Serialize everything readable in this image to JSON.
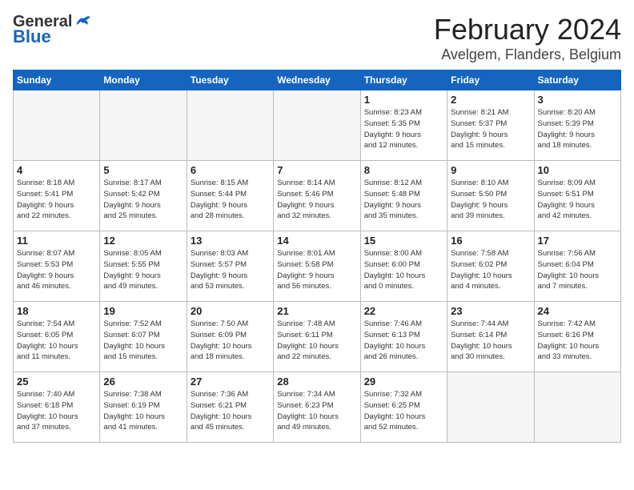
{
  "header": {
    "logo_general": "General",
    "logo_blue": "Blue",
    "month_year": "February 2024",
    "location": "Avelgem, Flanders, Belgium"
  },
  "weekdays": [
    "Sunday",
    "Monday",
    "Tuesday",
    "Wednesday",
    "Thursday",
    "Friday",
    "Saturday"
  ],
  "weeks": [
    [
      {
        "day": "",
        "info": ""
      },
      {
        "day": "",
        "info": ""
      },
      {
        "day": "",
        "info": ""
      },
      {
        "day": "",
        "info": ""
      },
      {
        "day": "1",
        "info": "Sunrise: 8:23 AM\nSunset: 5:35 PM\nDaylight: 9 hours\nand 12 minutes."
      },
      {
        "day": "2",
        "info": "Sunrise: 8:21 AM\nSunset: 5:37 PM\nDaylight: 9 hours\nand 15 minutes."
      },
      {
        "day": "3",
        "info": "Sunrise: 8:20 AM\nSunset: 5:39 PM\nDaylight: 9 hours\nand 18 minutes."
      }
    ],
    [
      {
        "day": "4",
        "info": "Sunrise: 8:18 AM\nSunset: 5:41 PM\nDaylight: 9 hours\nand 22 minutes."
      },
      {
        "day": "5",
        "info": "Sunrise: 8:17 AM\nSunset: 5:42 PM\nDaylight: 9 hours\nand 25 minutes."
      },
      {
        "day": "6",
        "info": "Sunrise: 8:15 AM\nSunset: 5:44 PM\nDaylight: 9 hours\nand 28 minutes."
      },
      {
        "day": "7",
        "info": "Sunrise: 8:14 AM\nSunset: 5:46 PM\nDaylight: 9 hours\nand 32 minutes."
      },
      {
        "day": "8",
        "info": "Sunrise: 8:12 AM\nSunset: 5:48 PM\nDaylight: 9 hours\nand 35 minutes."
      },
      {
        "day": "9",
        "info": "Sunrise: 8:10 AM\nSunset: 5:50 PM\nDaylight: 9 hours\nand 39 minutes."
      },
      {
        "day": "10",
        "info": "Sunrise: 8:09 AM\nSunset: 5:51 PM\nDaylight: 9 hours\nand 42 minutes."
      }
    ],
    [
      {
        "day": "11",
        "info": "Sunrise: 8:07 AM\nSunset: 5:53 PM\nDaylight: 9 hours\nand 46 minutes."
      },
      {
        "day": "12",
        "info": "Sunrise: 8:05 AM\nSunset: 5:55 PM\nDaylight: 9 hours\nand 49 minutes."
      },
      {
        "day": "13",
        "info": "Sunrise: 8:03 AM\nSunset: 5:57 PM\nDaylight: 9 hours\nand 53 minutes."
      },
      {
        "day": "14",
        "info": "Sunrise: 8:01 AM\nSunset: 5:58 PM\nDaylight: 9 hours\nand 56 minutes."
      },
      {
        "day": "15",
        "info": "Sunrise: 8:00 AM\nSunset: 6:00 PM\nDaylight: 10 hours\nand 0 minutes."
      },
      {
        "day": "16",
        "info": "Sunrise: 7:58 AM\nSunset: 6:02 PM\nDaylight: 10 hours\nand 4 minutes."
      },
      {
        "day": "17",
        "info": "Sunrise: 7:56 AM\nSunset: 6:04 PM\nDaylight: 10 hours\nand 7 minutes."
      }
    ],
    [
      {
        "day": "18",
        "info": "Sunrise: 7:54 AM\nSunset: 6:05 PM\nDaylight: 10 hours\nand 11 minutes."
      },
      {
        "day": "19",
        "info": "Sunrise: 7:52 AM\nSunset: 6:07 PM\nDaylight: 10 hours\nand 15 minutes."
      },
      {
        "day": "20",
        "info": "Sunrise: 7:50 AM\nSunset: 6:09 PM\nDaylight: 10 hours\nand 18 minutes."
      },
      {
        "day": "21",
        "info": "Sunrise: 7:48 AM\nSunset: 6:11 PM\nDaylight: 10 hours\nand 22 minutes."
      },
      {
        "day": "22",
        "info": "Sunrise: 7:46 AM\nSunset: 6:13 PM\nDaylight: 10 hours\nand 26 minutes."
      },
      {
        "day": "23",
        "info": "Sunrise: 7:44 AM\nSunset: 6:14 PM\nDaylight: 10 hours\nand 30 minutes."
      },
      {
        "day": "24",
        "info": "Sunrise: 7:42 AM\nSunset: 6:16 PM\nDaylight: 10 hours\nand 33 minutes."
      }
    ],
    [
      {
        "day": "25",
        "info": "Sunrise: 7:40 AM\nSunset: 6:18 PM\nDaylight: 10 hours\nand 37 minutes."
      },
      {
        "day": "26",
        "info": "Sunrise: 7:38 AM\nSunset: 6:19 PM\nDaylight: 10 hours\nand 41 minutes."
      },
      {
        "day": "27",
        "info": "Sunrise: 7:36 AM\nSunset: 6:21 PM\nDaylight: 10 hours\nand 45 minutes."
      },
      {
        "day": "28",
        "info": "Sunrise: 7:34 AM\nSunset: 6:23 PM\nDaylight: 10 hours\nand 49 minutes."
      },
      {
        "day": "29",
        "info": "Sunrise: 7:32 AM\nSunset: 6:25 PM\nDaylight: 10 hours\nand 52 minutes."
      },
      {
        "day": "",
        "info": ""
      },
      {
        "day": "",
        "info": ""
      }
    ]
  ]
}
